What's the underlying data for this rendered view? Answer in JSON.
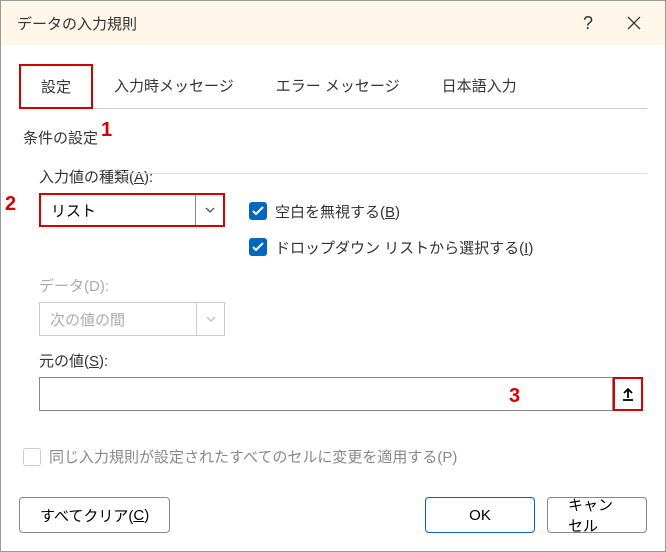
{
  "titlebar": {
    "title": "データの入力規則"
  },
  "tabs": {
    "settings": "設定",
    "input_msg": "入力時メッセージ",
    "error_msg": "エラー メッセージ",
    "ime": "日本語入力"
  },
  "fieldset": {
    "legend": "条件の設定"
  },
  "allow": {
    "label_pre": "入力値の種類(",
    "label_key": "A",
    "label_post": "):",
    "value": "リスト"
  },
  "ignore_blank": {
    "label_pre": "空白を無視する(",
    "label_key": "B",
    "label_post": ")"
  },
  "dropdown_list": {
    "label_pre": "ドロップダウン リストから選択する(",
    "label_key": "I",
    "label_post": ")"
  },
  "data": {
    "label": "データ(D):",
    "value": "次の値の間"
  },
  "source": {
    "label_pre": "元の値(",
    "label_key": "S",
    "label_post": "):",
    "value": ""
  },
  "apply_all": {
    "label": "同じ入力規則が設定されたすべてのセルに変更を適用する(P)"
  },
  "buttons": {
    "clear_pre": "すべてクリア(",
    "clear_key": "C",
    "clear_post": ")",
    "ok": "OK",
    "cancel": "キャンセル"
  },
  "annotations": {
    "a1": "1",
    "a2": "2",
    "a3": "3"
  }
}
